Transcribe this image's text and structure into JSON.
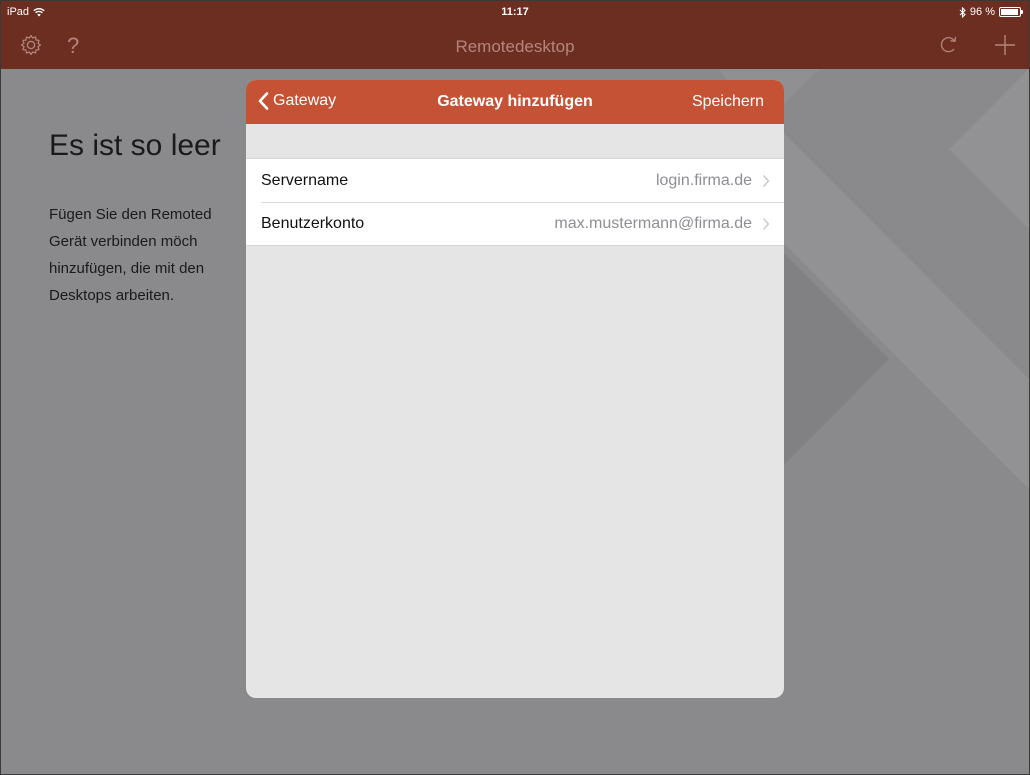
{
  "status_bar": {
    "device": "iPad",
    "time": "11:17",
    "battery": "96 %",
    "battery_level": 0.96
  },
  "nav": {
    "title": "Remotedesktop",
    "icons": [
      "gear-icon",
      "help-icon",
      "refresh-icon",
      "plus-icon"
    ]
  },
  "empty_state": {
    "heading": "Es ist so leer",
    "lines": [
      "Fügen Sie den Remoted",
      "Gerät  verbinden  möch",
      "hinzufügen, die mit den",
      "Desktops arbeiten."
    ]
  },
  "modal": {
    "back_label": "Gateway",
    "title": "Gateway hinzufügen",
    "save_label": "Speichern",
    "rows": [
      {
        "label": "Servername",
        "value": "login.firma.de"
      },
      {
        "label": "Benutzerkonto",
        "value": "max.mustermann@firma.de"
      }
    ]
  },
  "colors": {
    "nav_bar": "#6b2e21",
    "modal_header": "#c55234",
    "overlay": "#8a8a8d",
    "modal_bg": "#e5e5e5"
  }
}
